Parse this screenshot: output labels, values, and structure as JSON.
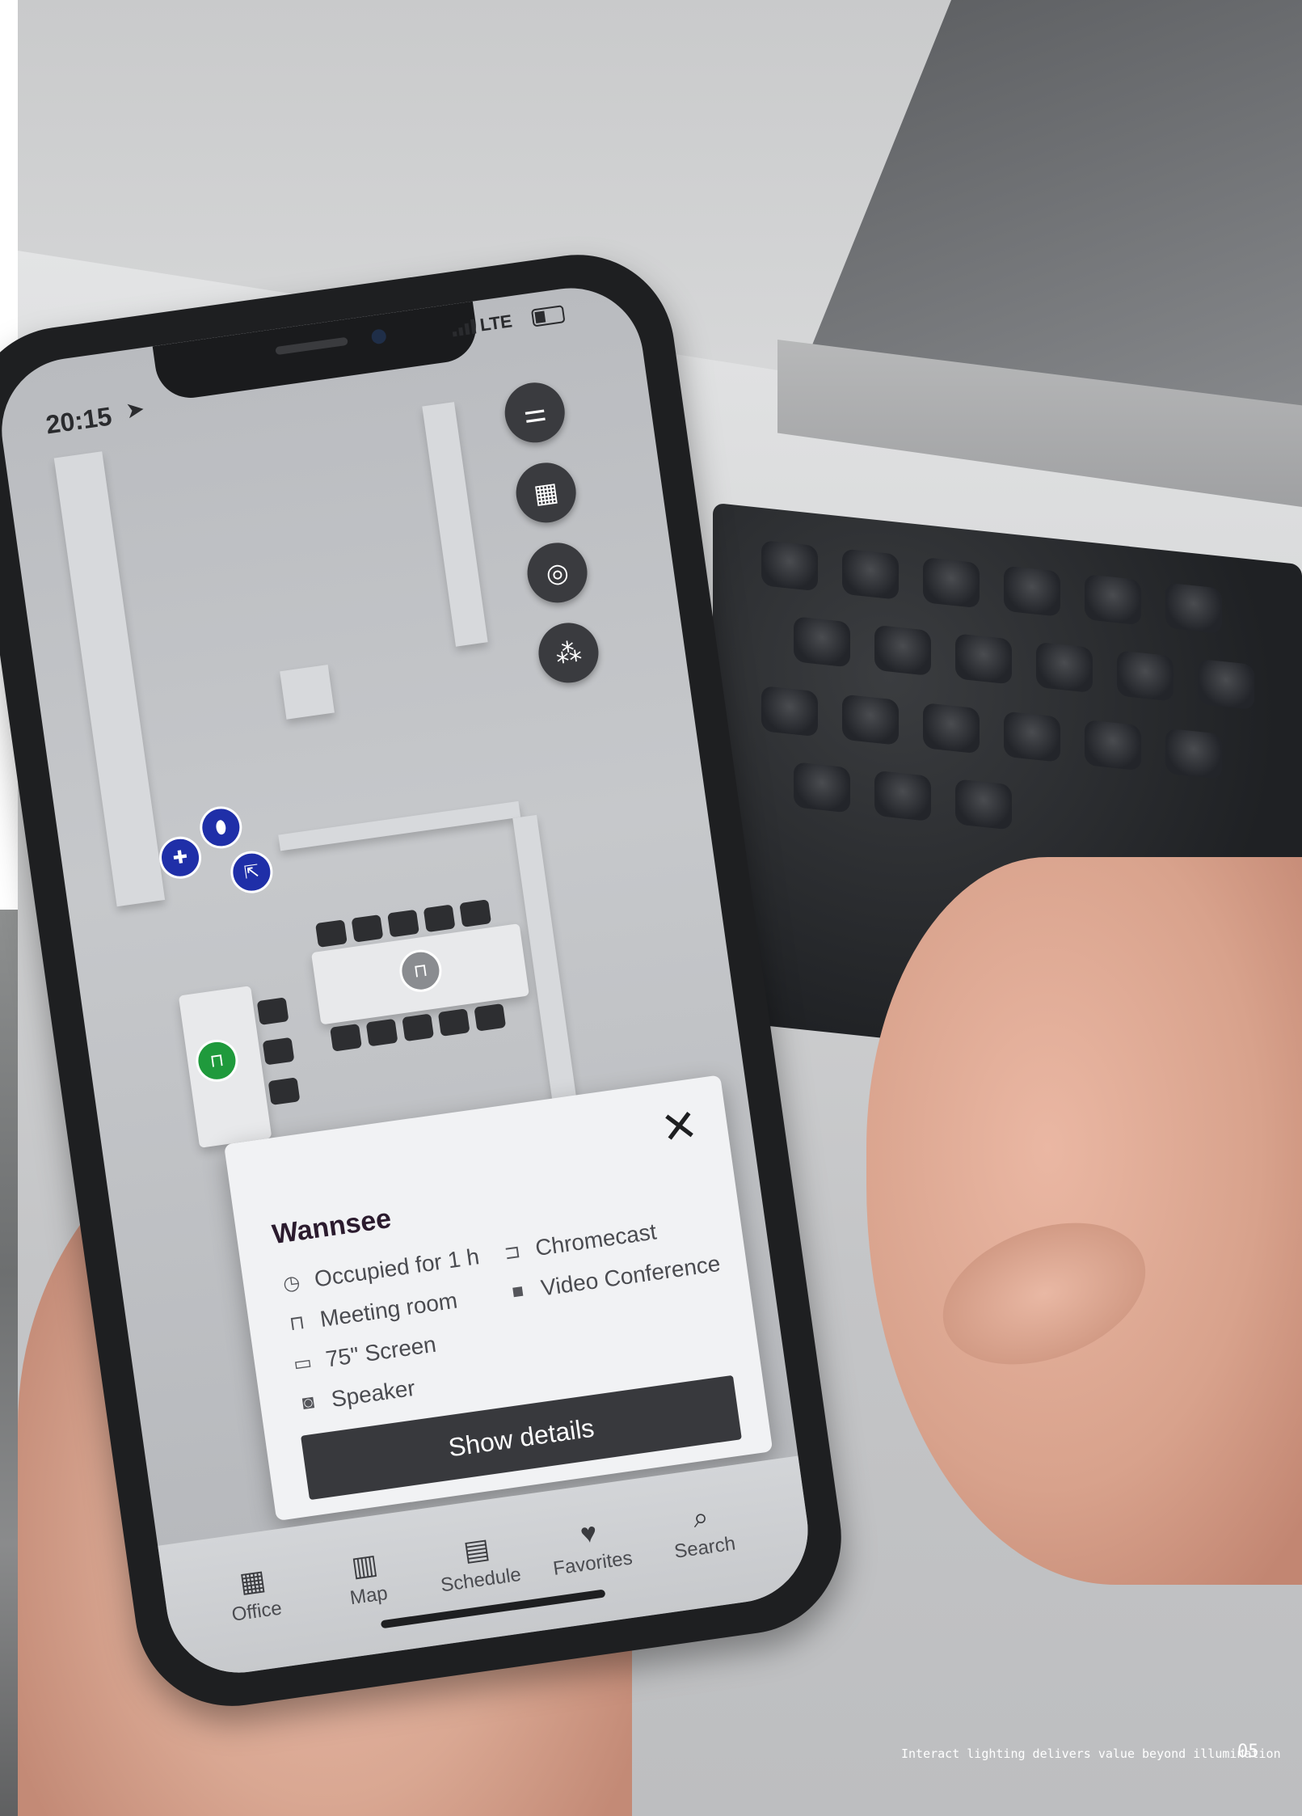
{
  "status_bar": {
    "time": "20:15",
    "network": "LTE"
  },
  "card": {
    "title": "Wannsee",
    "features": [
      {
        "icon": "clock-icon",
        "label": "Occupied for 1 h"
      },
      {
        "icon": "meeting-room-icon",
        "label": "Meeting room"
      },
      {
        "icon": "screen-icon",
        "label": "75\" Screen"
      },
      {
        "icon": "speaker-icon",
        "label": "Speaker"
      },
      {
        "icon": "cast-icon",
        "label": "Chromecast"
      },
      {
        "icon": "video-camera-icon",
        "label": "Video Conference"
      }
    ],
    "button": "Show details"
  },
  "tabs": [
    {
      "icon": "building-icon",
      "label": "Office"
    },
    {
      "icon": "map-icon",
      "label": "Map"
    },
    {
      "icon": "calendar-icon",
      "label": "Schedule"
    },
    {
      "icon": "heart-icon",
      "label": "Favorites"
    },
    {
      "icon": "search-icon",
      "label": "Search"
    }
  ],
  "map_controls": [
    "filter-icon",
    "building-icon",
    "locate-icon",
    "people-icon"
  ],
  "footer": {
    "caption": "Interact lighting delivers value beyond illumination",
    "page": "05"
  }
}
